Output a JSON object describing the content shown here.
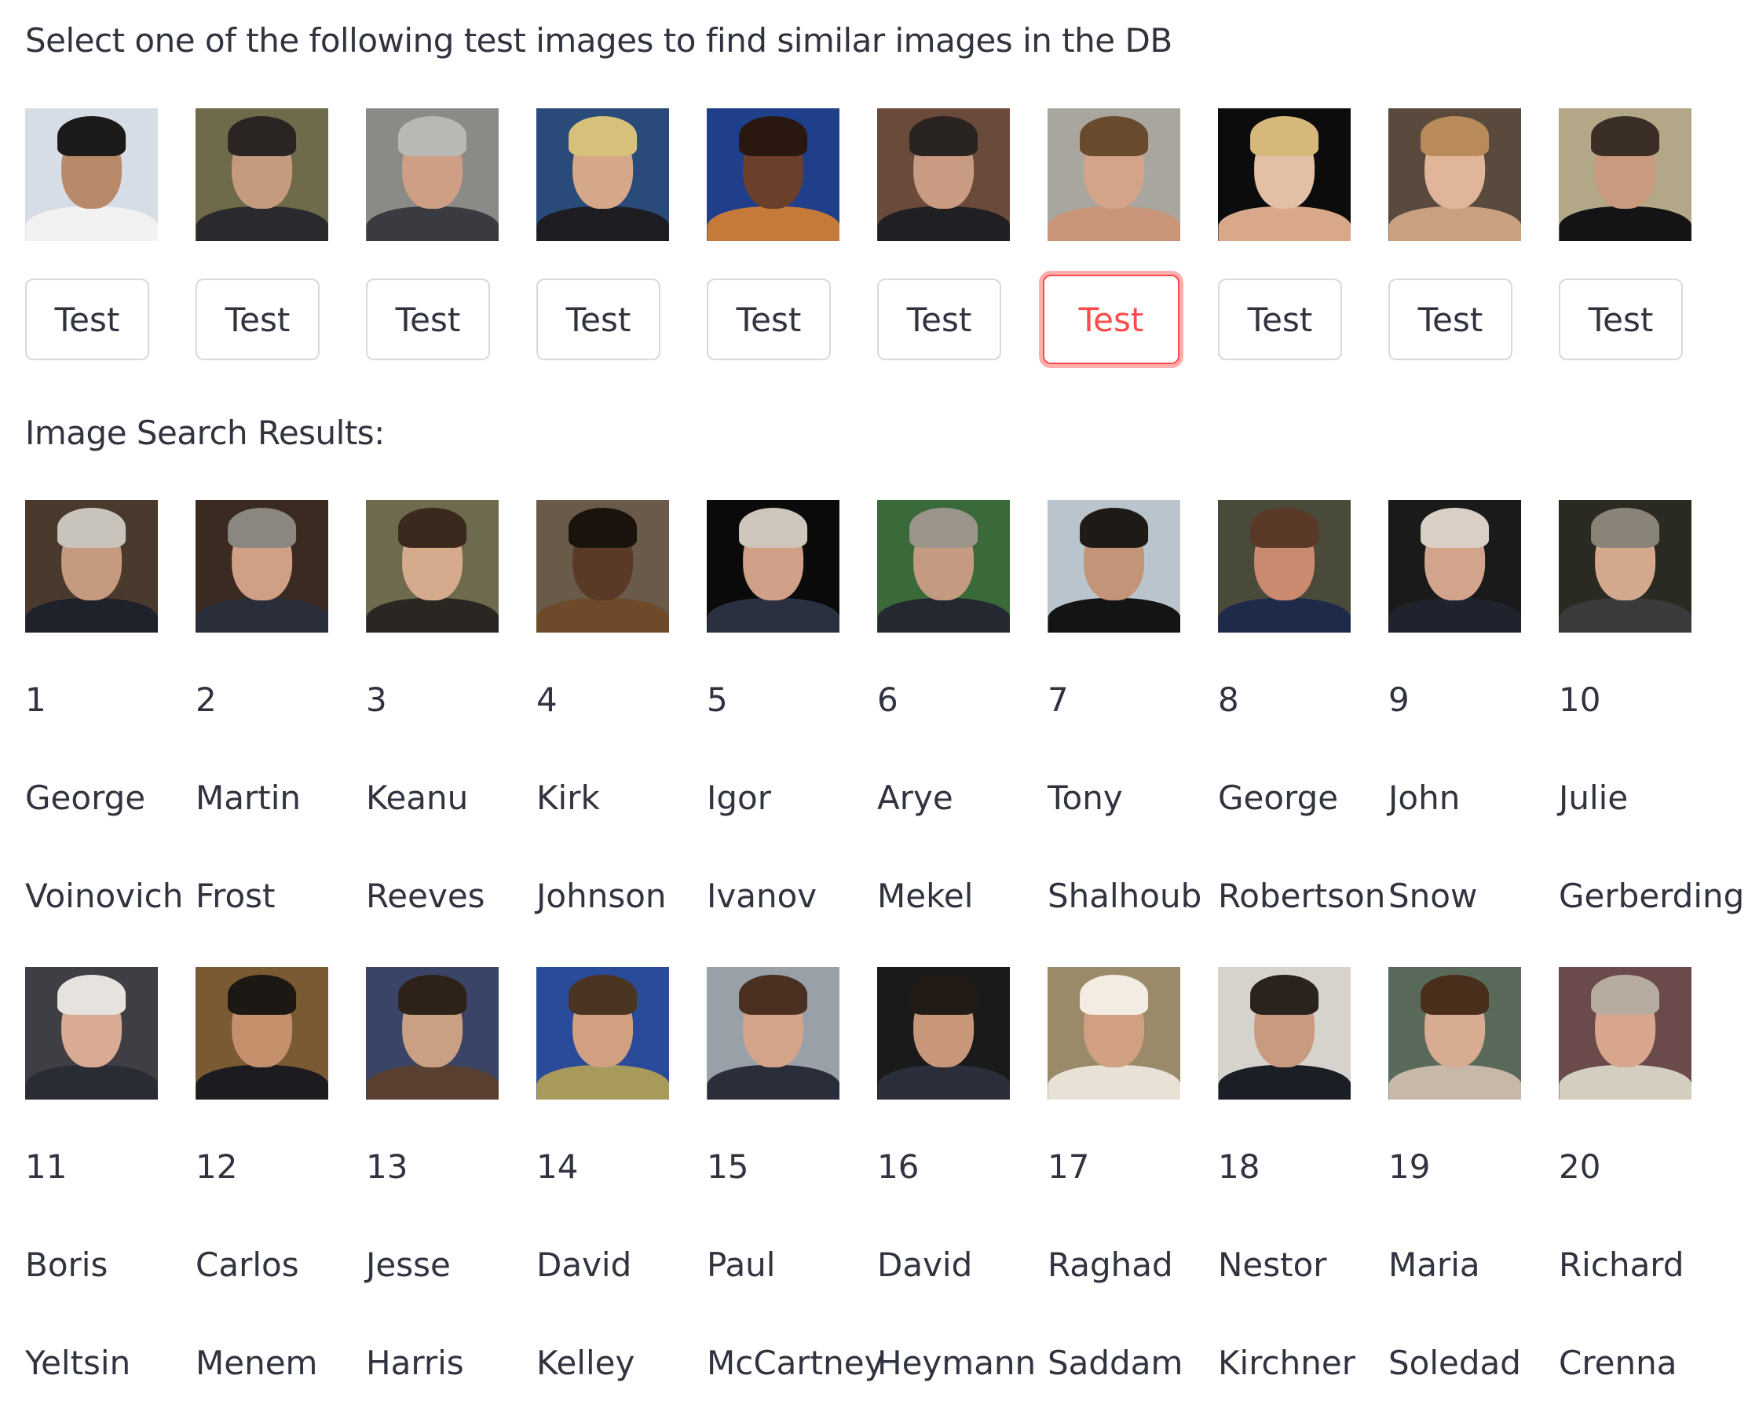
{
  "prompt": "Select one of the following test images to find similar images in the DB",
  "results_heading": "Image Search Results:",
  "test_images": [
    {
      "label": "Test",
      "selected": false,
      "bg": "#d7dde6",
      "skin": "#b98a6a",
      "hair": "#1c1a18",
      "shirt": "#f2f2f2"
    },
    {
      "label": "Test",
      "selected": false,
      "bg": "#6e6a4a",
      "skin": "#c59b80",
      "hair": "#2a2522",
      "shirt": "#2a2a2e"
    },
    {
      "label": "Test",
      "selected": false,
      "bg": "#8a8a86",
      "skin": "#cf9f85",
      "hair": "#b8b8b4",
      "shirt": "#3a3a40"
    },
    {
      "label": "Test",
      "selected": false,
      "bg": "#2a4a7a",
      "skin": "#d6a88a",
      "hair": "#d7c07a",
      "shirt": "#1d1d22"
    },
    {
      "label": "Test",
      "selected": false,
      "bg": "#1f3f8a",
      "skin": "#6b3f2a",
      "hair": "#2a170f",
      "shirt": "#c67a3a"
    },
    {
      "label": "Test",
      "selected": false,
      "bg": "#6a4a3a",
      "skin": "#c89b82",
      "hair": "#2a2420",
      "shirt": "#1f1f24"
    },
    {
      "label": "Test",
      "selected": true,
      "bg": "#a8a69e",
      "skin": "#d3a487",
      "hair": "#6a4a2c",
      "shirt": "#c99578"
    },
    {
      "label": "Test",
      "selected": false,
      "bg": "#0c0c0c",
      "skin": "#e3bfa5",
      "hair": "#d6b97a",
      "shirt": "#d9a88a"
    },
    {
      "label": "Test",
      "selected": false,
      "bg": "#5a4a3e",
      "skin": "#e0b59a",
      "hair": "#b98a5a",
      "shirt": "#c9a080"
    },
    {
      "label": "Test",
      "selected": false,
      "bg": "#b2a888",
      "skin": "#c99a7d",
      "hair": "#3a2e26",
      "shirt": "#141416"
    }
  ],
  "results": [
    {
      "rank": "1",
      "first": "George",
      "last": "Voinovich",
      "bg": "#4a3a2e",
      "skin": "#c59a7e",
      "hair": "#c8c4bc",
      "shirt": "#1f222a"
    },
    {
      "rank": "2",
      "first": "Martin",
      "last": "Frost",
      "bg": "#3a2a22",
      "skin": "#cf9f86",
      "hair": "#8a8680",
      "shirt": "#2a2e3a"
    },
    {
      "rank": "3",
      "first": "Keanu",
      "last": "Reeves",
      "bg": "#6e6a4e",
      "skin": "#d6aa8c",
      "hair": "#3a2a1e",
      "shirt": "#2a2622"
    },
    {
      "rank": "4",
      "first": "Kirk",
      "last": "Johnson",
      "bg": "#6a5a4a",
      "skin": "#5a3a26",
      "hair": "#1a120c",
      "shirt": "#6e4a2a"
    },
    {
      "rank": "5",
      "first": "Igor",
      "last": "Ivanov",
      "bg": "#0a0a0a",
      "skin": "#d0a088",
      "hair": "#cfc6bb",
      "shirt": "#2a3040"
    },
    {
      "rank": "6",
      "first": "Arye",
      "last": "Mekel",
      "bg": "#3a6a3a",
      "skin": "#c49a80",
      "hair": "#9a948a",
      "shirt": "#252830"
    },
    {
      "rank": "7",
      "first": "Tony",
      "last": "Shalhoub",
      "bg": "#b9c4cc",
      "skin": "#c29478",
      "hair": "#1e1a16",
      "shirt": "#141414"
    },
    {
      "rank": "8",
      "first": "George",
      "last": "Robertson",
      "bg": "#4a4a3a",
      "skin": "#c98a70",
      "hair": "#5a3a26",
      "shirt": "#1e2a4a"
    },
    {
      "rank": "9",
      "first": "John",
      "last": "Snow",
      "bg": "#1a1a1a",
      "skin": "#d3a48c",
      "hair": "#d9cfc4",
      "shirt": "#20232e"
    },
    {
      "rank": "10",
      "first": "Julie",
      "last": "Gerberding",
      "bg": "#2a2a22",
      "skin": "#d4a88c",
      "hair": "#8a8478",
      "shirt": "#3a3a3a"
    },
    {
      "rank": "11",
      "first": "Boris",
      "last": "Yeltsin",
      "bg": "#3e3e44",
      "skin": "#d8ab92",
      "hair": "#e6e3de",
      "shirt": "#2a2c34"
    },
    {
      "rank": "12",
      "first": "Carlos",
      "last": "Menem",
      "bg": "#7a5a32",
      "skin": "#c4906c",
      "hair": "#1c1814",
      "shirt": "#1c1c20"
    },
    {
      "rank": "13",
      "first": "Jesse",
      "last": "Harris",
      "bg": "#3a4466",
      "skin": "#caa084",
      "hair": "#2e2218",
      "shirt": "#5a4030"
    },
    {
      "rank": "14",
      "first": "David",
      "last": "Kelley",
      "bg": "#2a4a9a",
      "skin": "#d0a080",
      "hair": "#4a3422",
      "shirt": "#a89a5a"
    },
    {
      "rank": "15",
      "first": "Paul",
      "last": "McCartney",
      "bg": "#9aa0a8",
      "skin": "#d4a48a",
      "hair": "#4a3020",
      "shirt": "#2a2e3a"
    },
    {
      "rank": "16",
      "first": "David",
      "last": "Heymann",
      "bg": "#1a1a1a",
      "skin": "#c8977a",
      "hair": "#221a14",
      "shirt": "#2a2e3a"
    },
    {
      "rank": "17",
      "first": "Raghad",
      "last": "Saddam",
      "bg": "#9a8a6a",
      "skin": "#d0a080",
      "hair": "#f2ece2",
      "shirt": "#e8e2d6"
    },
    {
      "rank": "18",
      "first": "Nestor",
      "last": "Kirchner",
      "bg": "#d6d2cc",
      "skin": "#c89a7e",
      "hair": "#2a221c",
      "shirt": "#1c1e26"
    },
    {
      "rank": "19",
      "first": "Maria",
      "last": "Soledad",
      "bg": "#5a6a5a",
      "skin": "#d8ac90",
      "hair": "#4a2e1c",
      "shirt": "#c8b8a8"
    },
    {
      "rank": "20",
      "first": "Richard",
      "last": "Crenna",
      "bg": "#6a4a4a",
      "skin": "#d7a68c",
      "hair": "#b8aca0",
      "shirt": "#d4cec0"
    }
  ]
}
